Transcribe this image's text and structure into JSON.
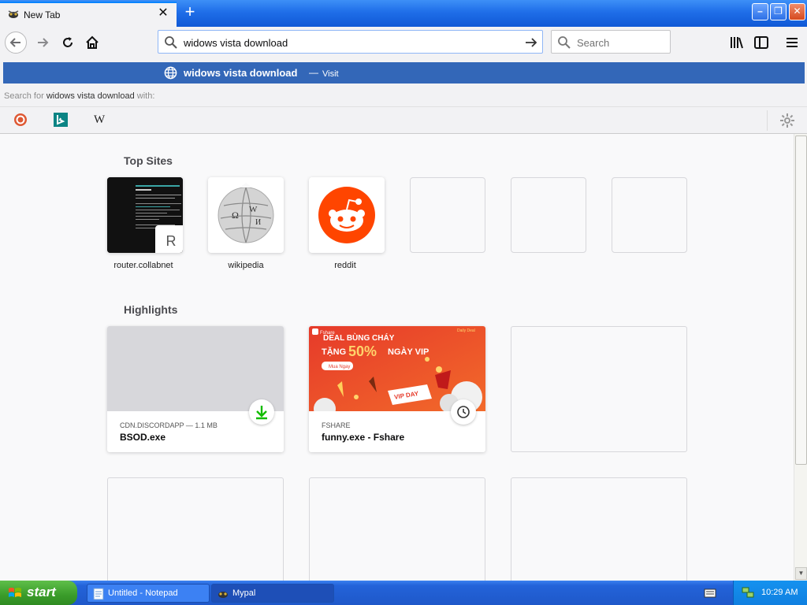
{
  "tab": {
    "title": "New Tab",
    "close": "✕",
    "new": "+"
  },
  "window": {
    "minimize": "–",
    "maximize": "❐",
    "close": "✕"
  },
  "urlbar": {
    "value": "widows vista download"
  },
  "searchbar": {
    "placeholder": "Search"
  },
  "suggestion": {
    "text": "widows vista download",
    "dash": "—",
    "action": "Visit"
  },
  "search_for": {
    "prefix": "Search for ",
    "query": "widows vista download",
    "suffix": " with:"
  },
  "engines": {
    "ddg": "DuckDuckGo",
    "bing": "b",
    "wiki": "W"
  },
  "top_sites": {
    "heading": "Top Sites",
    "sites": [
      {
        "label": "router.collabnet",
        "letter": "R"
      },
      {
        "label": "wikipedia"
      },
      {
        "label": "reddit"
      }
    ]
  },
  "highlights": {
    "heading": "Highlights",
    "cards": [
      {
        "meta": "CDN.DISCORDAPP — 1.1 MB",
        "name": "BSOD.exe"
      },
      {
        "meta": "FSHARE",
        "name": "funny.exe - Fshare",
        "banner": {
          "brand": "Fshare",
          "tag": "Daily Deal",
          "line1": "DEAL BÙNG CHÁY",
          "line2a": "TẶNG",
          "line2b": "50%",
          "line2c": "NGÀY VIP",
          "pill": "Mua Ngay",
          "vip": "VIP DAY"
        }
      }
    ]
  },
  "taskbar": {
    "start": "start",
    "tasks": [
      {
        "label": "Untitled - Notepad"
      },
      {
        "label": "Mypal"
      }
    ],
    "clock": "10:29 AM"
  },
  "colors": {
    "accent": "#3367b8",
    "tab_bar": "#1f6ee8",
    "reddit": "#ff4500",
    "download": "#12bc00"
  }
}
